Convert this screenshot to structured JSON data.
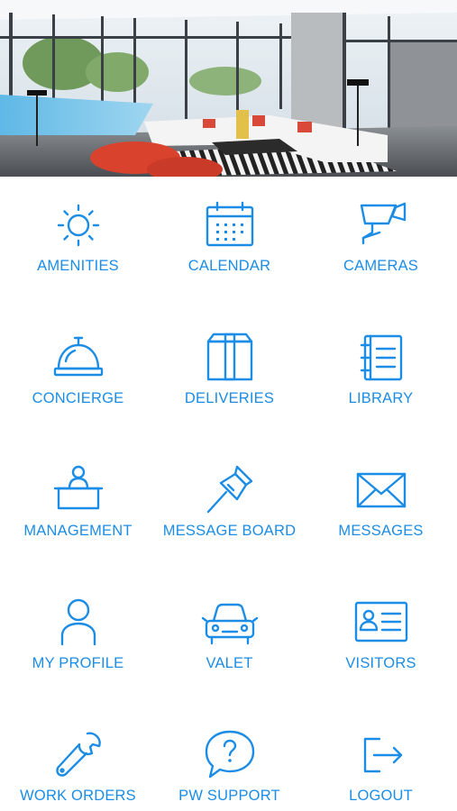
{
  "brand_color": "#1b8de6",
  "hero": {
    "image": "modern-lounge-interior"
  },
  "menu": [
    {
      "label": "AMENITIES",
      "icon": "sun-icon"
    },
    {
      "label": "CALENDAR",
      "icon": "calendar-icon"
    },
    {
      "label": "CAMERAS",
      "icon": "security-camera-icon"
    },
    {
      "label": "CONCIERGE",
      "icon": "service-bell-icon"
    },
    {
      "label": "DELIVERIES",
      "icon": "package-icon"
    },
    {
      "label": "LIBRARY",
      "icon": "notebook-icon"
    },
    {
      "label": "MANAGEMENT",
      "icon": "front-desk-icon"
    },
    {
      "label": "MESSAGE BOARD",
      "icon": "pushpin-icon"
    },
    {
      "label": "MESSAGES",
      "icon": "envelope-icon"
    },
    {
      "label": "MY PROFILE",
      "icon": "person-icon"
    },
    {
      "label": "VALET",
      "icon": "car-icon"
    },
    {
      "label": "VISITORS",
      "icon": "id-card-icon"
    },
    {
      "label": "WORK ORDERS",
      "icon": "wrench-icon"
    },
    {
      "label": "PW SUPPORT",
      "icon": "help-bubble-icon"
    },
    {
      "label": "LOGOUT",
      "icon": "logout-icon"
    }
  ]
}
